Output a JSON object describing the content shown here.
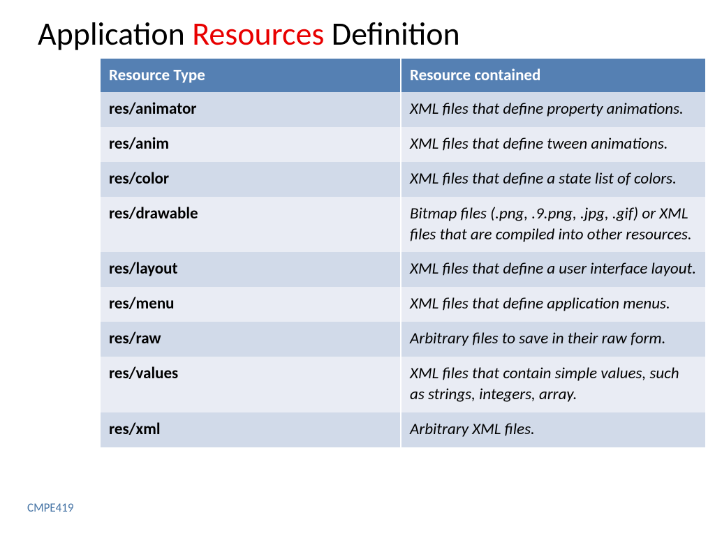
{
  "title": {
    "part1": "Application ",
    "highlight": "Resources",
    "part2": " Definition"
  },
  "headers": {
    "col1": "Resource Type",
    "col2": "Resource contained"
  },
  "rows": [
    {
      "type": "res/animator",
      "contained": "XML files that define property animations."
    },
    {
      "type": "res/anim",
      "contained": "XML files that define tween animations."
    },
    {
      "type": "res/color",
      "contained": "XML files that define a state list of colors."
    },
    {
      "type": "res/drawable",
      "contained": "Bitmap files (.png, .9.png, .jpg, .gif) or XML files that are compiled into other resources."
    },
    {
      "type": "res/layout",
      "contained": "XML files that define a user interface layout."
    },
    {
      "type": "res/menu",
      "contained": "XML files that define application menus."
    },
    {
      "type": "res/raw",
      "contained": "Arbitrary files to save in their raw form."
    },
    {
      "type": "res/values",
      "contained": "XML files that contain simple values, such as strings, integers, array."
    },
    {
      "type": "res/xml",
      "contained": "Arbitrary XML files."
    }
  ],
  "footer": "CMPE419"
}
